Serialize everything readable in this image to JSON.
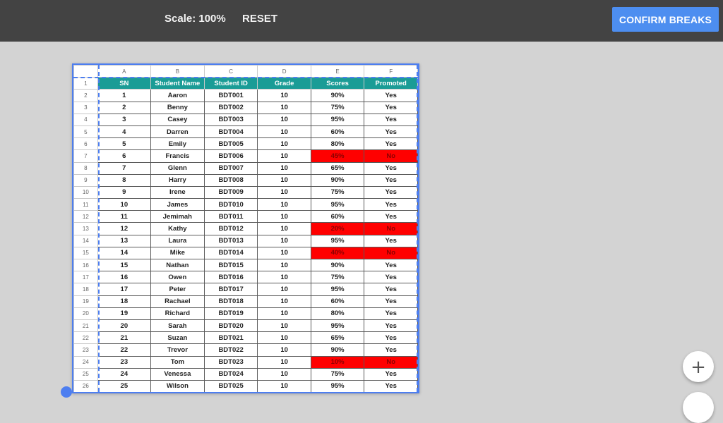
{
  "toolbar": {
    "scale_label": "Scale: 100%",
    "reset_label": "RESET",
    "confirm_label": "CONFIRM BREAKS"
  },
  "colors": {
    "toolbar_bg": "#434343",
    "accent": "#4d8ef0",
    "header_fill": "#1a9c96",
    "fail_fill": "#ff0000"
  },
  "sheet": {
    "column_letters": [
      "A",
      "B",
      "C",
      "D",
      "E",
      "F"
    ],
    "headers": [
      "SN",
      "Student Name",
      "Student ID",
      "Grade",
      "Scores",
      "Promoted"
    ],
    "rows": [
      {
        "row": "2",
        "sn": "1",
        "name": "Aaron",
        "id": "BDT001",
        "grade": "10",
        "score": "90%",
        "promoted": "Yes"
      },
      {
        "row": "3",
        "sn": "2",
        "name": "Benny",
        "id": "BDT002",
        "grade": "10",
        "score": "75%",
        "promoted": "Yes"
      },
      {
        "row": "4",
        "sn": "3",
        "name": "Casey",
        "id": "BDT003",
        "grade": "10",
        "score": "95%",
        "promoted": "Yes"
      },
      {
        "row": "5",
        "sn": "4",
        "name": "Darren",
        "id": "BDT004",
        "grade": "10",
        "score": "60%",
        "promoted": "Yes"
      },
      {
        "row": "6",
        "sn": "5",
        "name": "Emily",
        "id": "BDT005",
        "grade": "10",
        "score": "80%",
        "promoted": "Yes"
      },
      {
        "row": "7",
        "sn": "6",
        "name": "Francis",
        "id": "BDT006",
        "grade": "10",
        "score": "45%",
        "promoted": "No"
      },
      {
        "row": "8",
        "sn": "7",
        "name": "Glenn",
        "id": "BDT007",
        "grade": "10",
        "score": "65%",
        "promoted": "Yes"
      },
      {
        "row": "9",
        "sn": "8",
        "name": "Harry",
        "id": "BDT008",
        "grade": "10",
        "score": "90%",
        "promoted": "Yes"
      },
      {
        "row": "10",
        "sn": "9",
        "name": "Irene",
        "id": "BDT009",
        "grade": "10",
        "score": "75%",
        "promoted": "Yes"
      },
      {
        "row": "11",
        "sn": "10",
        "name": "James",
        "id": "BDT010",
        "grade": "10",
        "score": "95%",
        "promoted": "Yes"
      },
      {
        "row": "12",
        "sn": "11",
        "name": "Jemimah",
        "id": "BDT011",
        "grade": "10",
        "score": "60%",
        "promoted": "Yes"
      },
      {
        "row": "13",
        "sn": "12",
        "name": "Kathy",
        "id": "BDT012",
        "grade": "10",
        "score": "20%",
        "promoted": "No"
      },
      {
        "row": "14",
        "sn": "13",
        "name": "Laura",
        "id": "BDT013",
        "grade": "10",
        "score": "95%",
        "promoted": "Yes"
      },
      {
        "row": "15",
        "sn": "14",
        "name": "Mike",
        "id": "BDT014",
        "grade": "10",
        "score": "40%",
        "promoted": "No"
      },
      {
        "row": "16",
        "sn": "15",
        "name": "Nathan",
        "id": "BDT015",
        "grade": "10",
        "score": "90%",
        "promoted": "Yes"
      },
      {
        "row": "17",
        "sn": "16",
        "name": "Owen",
        "id": "BDT016",
        "grade": "10",
        "score": "75%",
        "promoted": "Yes"
      },
      {
        "row": "18",
        "sn": "17",
        "name": "Peter",
        "id": "BDT017",
        "grade": "10",
        "score": "95%",
        "promoted": "Yes"
      },
      {
        "row": "19",
        "sn": "18",
        "name": "Rachael",
        "id": "BDT018",
        "grade": "10",
        "score": "60%",
        "promoted": "Yes"
      },
      {
        "row": "20",
        "sn": "19",
        "name": "Richard",
        "id": "BDT019",
        "grade": "10",
        "score": "80%",
        "promoted": "Yes"
      },
      {
        "row": "21",
        "sn": "20",
        "name": "Sarah",
        "id": "BDT020",
        "grade": "10",
        "score": "95%",
        "promoted": "Yes"
      },
      {
        "row": "22",
        "sn": "21",
        "name": "Suzan",
        "id": "BDT021",
        "grade": "10",
        "score": "65%",
        "promoted": "Yes"
      },
      {
        "row": "23",
        "sn": "22",
        "name": "Trevor",
        "id": "BDT022",
        "grade": "10",
        "score": "90%",
        "promoted": "Yes"
      },
      {
        "row": "24",
        "sn": "23",
        "name": "Tom",
        "id": "BDT023",
        "grade": "10",
        "score": "10%",
        "promoted": "No"
      },
      {
        "row": "25",
        "sn": "24",
        "name": "Venessa",
        "id": "BDT024",
        "grade": "10",
        "score": "75%",
        "promoted": "Yes"
      },
      {
        "row": "26",
        "sn": "25",
        "name": "Wilson",
        "id": "BDT025",
        "grade": "10",
        "score": "95%",
        "promoted": "Yes"
      }
    ]
  },
  "fab": {
    "plus_icon": "plus-icon"
  }
}
